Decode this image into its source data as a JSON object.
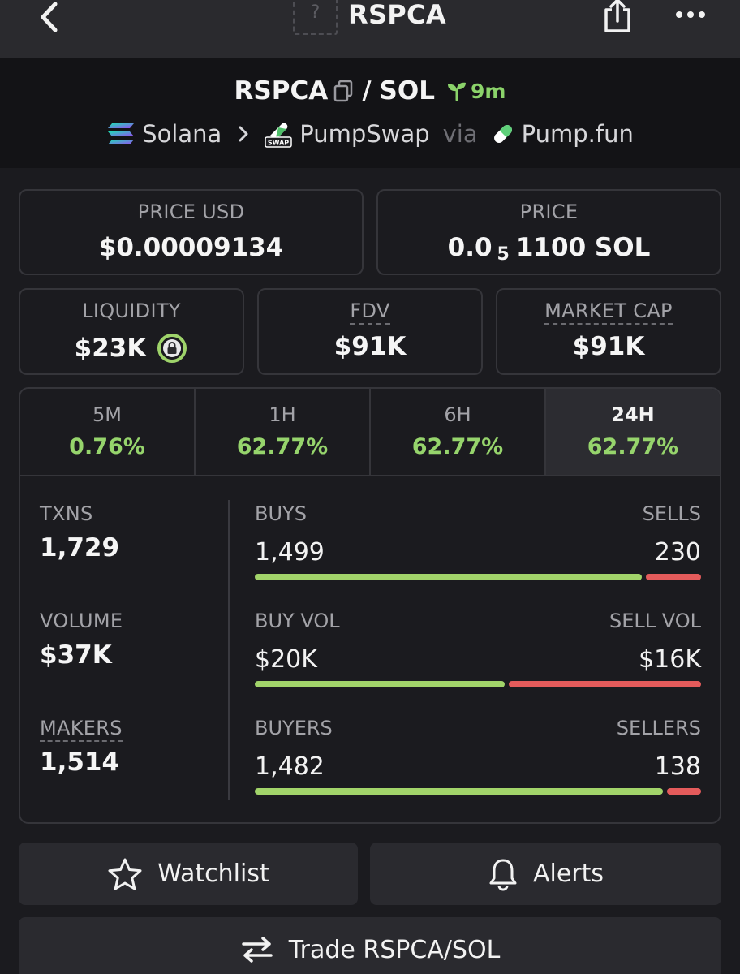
{
  "nav": {
    "title": "RSPCA",
    "avatar_placeholder": "?"
  },
  "pair": {
    "base": "RSPCA",
    "separator": "/",
    "quote": "SOL",
    "age": "9m"
  },
  "route": {
    "chain": "Solana",
    "dex": "PumpSwap",
    "via": "via",
    "launchpad": "Pump.fun"
  },
  "stats": {
    "price_usd_label": "PRICE USD",
    "price_usd_value": "$0.00009134",
    "price_label": "PRICE",
    "price_prefix": "0.0",
    "price_zero_count": "5",
    "price_suffix": "1100 SOL",
    "liquidity_label": "LIQUIDITY",
    "liquidity_value": "$23K",
    "fdv_label": "FDV",
    "fdv_value": "$91K",
    "mcap_label": "MARKET CAP",
    "mcap_value": "$91K"
  },
  "timeframes": [
    {
      "label": "5M",
      "change": "0.76%"
    },
    {
      "label": "1H",
      "change": "62.77%"
    },
    {
      "label": "6H",
      "change": "62.77%"
    },
    {
      "label": "24H",
      "change": "62.77%",
      "active": true
    }
  ],
  "metrics": {
    "txns_label": "TXNS",
    "txns_value": "1,729",
    "volume_label": "VOLUME",
    "volume_value": "$37K",
    "makers_label": "MAKERS",
    "makers_value": "1,514"
  },
  "splits": {
    "buys_label": "BUYS",
    "sells_label": "SELLS",
    "buys_value": "1,499",
    "sells_value": "230",
    "buys_fraction": 0.867,
    "buyvol_label": "BUY VOL",
    "sellvol_label": "SELL VOL",
    "buyvol_value": "$20K",
    "sellvol_value": "$16K",
    "buyvol_fraction": 0.56,
    "buyers_label": "BUYERS",
    "sellers_label": "SELLERS",
    "buyers_value": "1,482",
    "sellers_value": "138",
    "buyers_fraction": 0.915
  },
  "actions": {
    "watchlist": "Watchlist",
    "alerts": "Alerts",
    "trade": "Trade RSPCA/SOL"
  },
  "colors": {
    "positive": "#96d46c",
    "buy_bar": "#a2d46a",
    "sell_bar": "#e45b5b",
    "age_green": "#8bd36a"
  }
}
